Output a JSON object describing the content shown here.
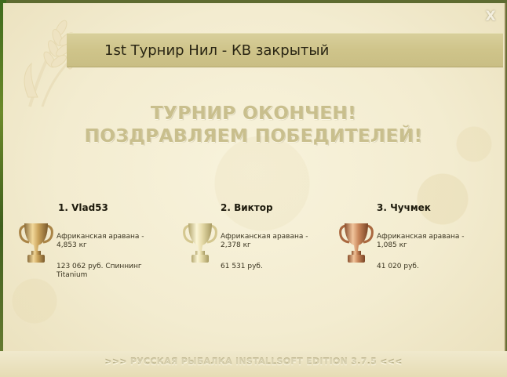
{
  "window": {
    "title": "1st Турнир Нил - КВ закрытый",
    "close_label": "X"
  },
  "announcement": {
    "line1": "ТУРНИР ОКОНЧЕН!",
    "line2": "ПОЗДРАВЛЯЕМ ПОБЕДИТЕЛЕЙ!"
  },
  "winners": [
    {
      "place_name": "1. Vlad53",
      "cup": "gold-trophy-icon",
      "fish": "Африканская аравана - 4,853 кг",
      "prize": "123 062 руб. Спиннинг Titanium"
    },
    {
      "place_name": "2. Виктор",
      "cup": "silver-trophy-icon",
      "fish": "Африканская аравана - 2,378 кг",
      "prize": "61 531 руб."
    },
    {
      "place_name": "3. Чучмек",
      "cup": "bronze-trophy-icon",
      "fish": "Африканская аравана - 1,085 кг",
      "prize": "41 020 руб."
    }
  ],
  "footer": {
    "text": ">>> РУССКАЯ РЫБАЛКА INSTALLSOFT EDITION 3.7.5 <<<"
  },
  "colors": {
    "panel_bg": "#f3ecd0",
    "title_bar": "#cfc48a",
    "heading": "#c9bf8d",
    "gold": "#c9a25a",
    "silver": "#e4d9a6",
    "bronze": "#c8865a"
  }
}
